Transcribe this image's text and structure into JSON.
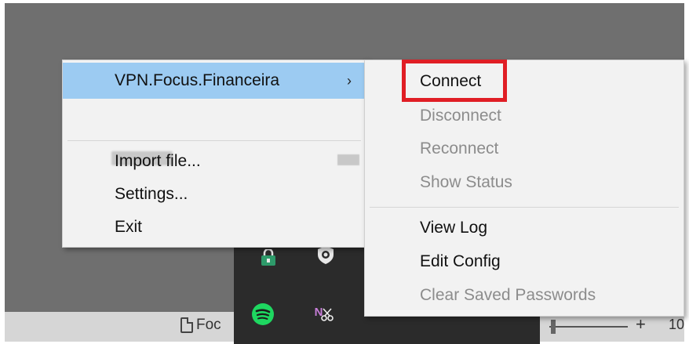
{
  "main_menu": {
    "items": [
      {
        "label": "VPN.Focus.Financeira",
        "arrow": "›",
        "highlighted": true
      },
      {
        "label": "Import file..."
      },
      {
        "label": "Settings..."
      },
      {
        "label": "Exit"
      }
    ]
  },
  "sub_menu": {
    "items": [
      {
        "label": "Connect",
        "enabled": true
      },
      {
        "label": "Disconnect",
        "enabled": false
      },
      {
        "label": "Reconnect",
        "enabled": false
      },
      {
        "label": "Show Status",
        "enabled": false
      },
      {
        "label": "View Log",
        "enabled": true
      },
      {
        "label": "Edit Config",
        "enabled": true
      },
      {
        "label": "Clear Saved Passwords",
        "enabled": false
      }
    ]
  },
  "statusbar": {
    "doc_text": "Foc",
    "zoom_plus": "+",
    "zoom_value": "10"
  },
  "tray": {
    "icons": [
      "lock-icon",
      "shield-icon",
      "spotify-icon",
      "onenote-icon"
    ],
    "onenote_glyph": "N"
  },
  "colors": {
    "highlight": "#9ccbf2",
    "callout": "#e01e25",
    "spotify": "#1ed760",
    "disabled_text": "#8c8c8c"
  }
}
